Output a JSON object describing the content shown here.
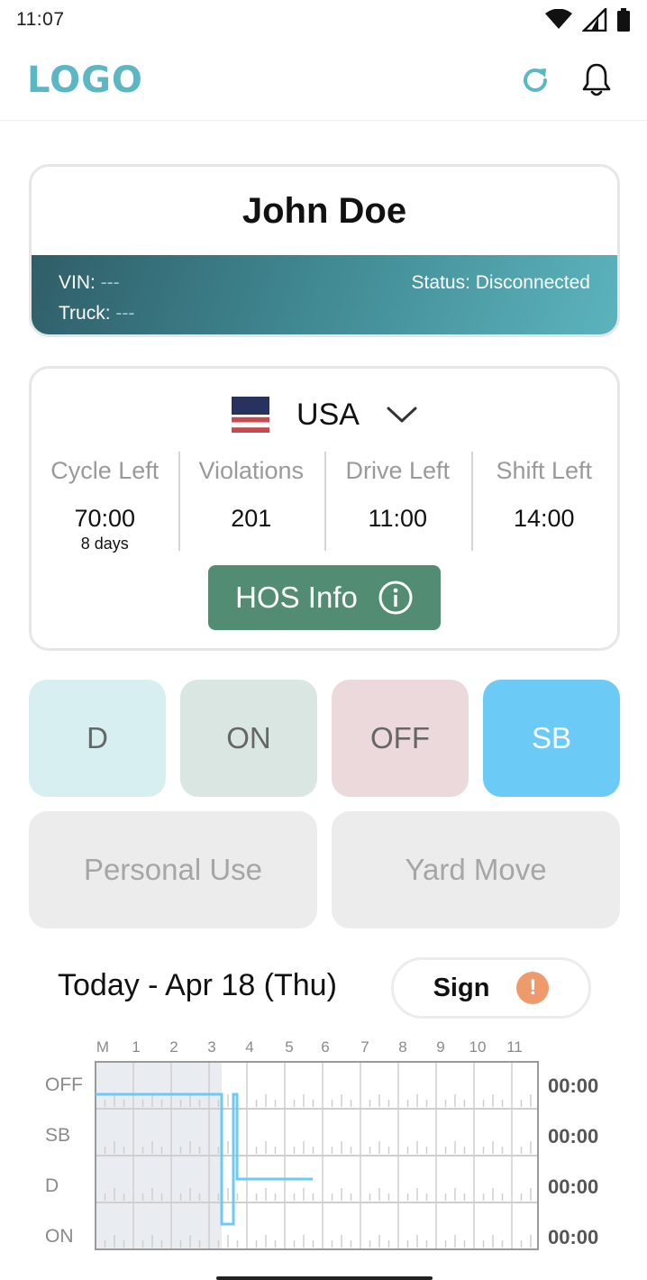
{
  "status_bar": {
    "time": "11:07",
    "icons": [
      "wifi-icon",
      "signal-icon",
      "battery-icon"
    ]
  },
  "header": {
    "logo": "LOGO",
    "actions": [
      "refresh-icon",
      "bell-icon"
    ],
    "brand_color": "#5bb7c3"
  },
  "driver": {
    "name": "John Doe",
    "vin_label": "VIN:",
    "vin_value": "---",
    "truck_label": "Truck:",
    "truck_value": "---",
    "status": "Status: Disconnected"
  },
  "hos": {
    "country": "USA",
    "country_flag": "us-flag-icon",
    "stats": [
      {
        "label": "Cycle Left",
        "value": "70:00",
        "sub": "8 days"
      },
      {
        "label": "Violations",
        "value": "201",
        "sub": ""
      },
      {
        "label": "Drive Left",
        "value": "11:00",
        "sub": ""
      },
      {
        "label": "Shift Left",
        "value": "14:00",
        "sub": ""
      }
    ],
    "info_button": "HOS Info",
    "info_button_color": "#528d73"
  },
  "duty_status": {
    "buttons": [
      "D",
      "ON",
      "OFF",
      "SB"
    ],
    "selected": "SB",
    "special": [
      "Personal Use",
      "Yard Move"
    ]
  },
  "log": {
    "title": "Today - Apr 18 (Thu)",
    "sign_label": "Sign",
    "sign_warning": "!",
    "hours": [
      "M",
      "1",
      "2",
      "3",
      "4",
      "5",
      "6",
      "7",
      "8",
      "9",
      "10",
      "11"
    ],
    "rows": [
      "OFF",
      "SB",
      "D",
      "ON"
    ],
    "totals": [
      "00:00",
      "00:00",
      "00:00",
      "00:00"
    ],
    "line_color": "#6ccbf6"
  }
}
